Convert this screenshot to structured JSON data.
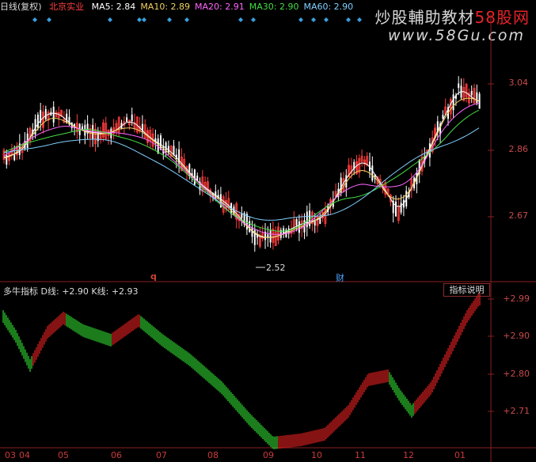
{
  "header": {
    "chart_label": "日线(复权)",
    "stock_name": "北京实业",
    "ma": [
      {
        "label": "MA5:",
        "value": "2.84",
        "color": "#ffffff"
      },
      {
        "label": "MA10:",
        "value": "2.89",
        "color": "#f0d060"
      },
      {
        "label": "MA20:",
        "value": "2.91",
        "color": "#ff66ff"
      },
      {
        "label": "MA30:",
        "value": "2.90",
        "color": "#44dd44"
      },
      {
        "label": "MA60:",
        "value": "2.90",
        "color": "#80d0ff"
      }
    ]
  },
  "watermark": {
    "line1_prefix": "炒股輔助教材",
    "line1_suffix": "58股网",
    "line2": "www.58Gu.com"
  },
  "price_axis": [
    "3.04",
    "2.86",
    "2.67"
  ],
  "min_price_label": "2.52",
  "event_marks": {
    "q": "q",
    "cai": "财"
  },
  "indicator": {
    "title": "多牛指标",
    "d_label": "D线:",
    "d_value": "+2.90",
    "k_label": "K线:",
    "k_value": "+2.93",
    "button": "指标说明",
    "axis": [
      "+2.99",
      "+2.90",
      "+2.80",
      "+2.71"
    ]
  },
  "x_axis": [
    "03",
    "04",
    "05",
    "06",
    "07",
    "08",
    "09",
    "10",
    "11",
    "12",
    "01"
  ],
  "chart_data": {
    "type": "candlestick",
    "title": "",
    "indicator_series": [
      {
        "name": "D线",
        "last": 2.9
      },
      {
        "name": "K线",
        "last": 2.93
      }
    ],
    "ylim": [
      2.52,
      3.1
    ]
  }
}
